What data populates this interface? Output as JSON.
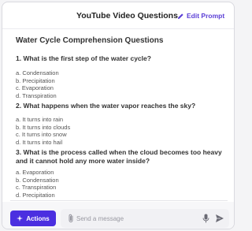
{
  "header": {
    "title": "YouTube Video Questions",
    "edit_label": "Edit Prompt"
  },
  "document": {
    "title": "Water Cycle Comprehension Questions",
    "questions": [
      {
        "text": "1. What is the first step of the water cycle?",
        "options": [
          "a. Condensation",
          "b. Precipitation",
          "c. Evaporation",
          "d. Transpiration"
        ]
      },
      {
        "text": "2. What happens when the water vapor reaches the sky?",
        "options": [
          "a. It turns into rain",
          "b. It turns into clouds",
          "c. It turns into snow",
          "d. It turns into hail"
        ]
      },
      {
        "text": "3. What is the process called when the cloud becomes too heavy and it cannot hold any more water inside?",
        "options": [
          "a. Evaporation",
          "b. Condensation",
          "c. Transpiration",
          "d. Precipitation"
        ]
      }
    ]
  },
  "footer": {
    "actions_label": "Actions",
    "message_placeholder": "Send a message"
  },
  "icons": {
    "edit": "pencil-icon",
    "actions": "sparkle-icon",
    "attach": "paperclip-icon",
    "mic": "mic-icon",
    "send": "send-icon"
  },
  "colors": {
    "accent": "#4b2fe0",
    "accent_text": "#5b3fd6"
  }
}
